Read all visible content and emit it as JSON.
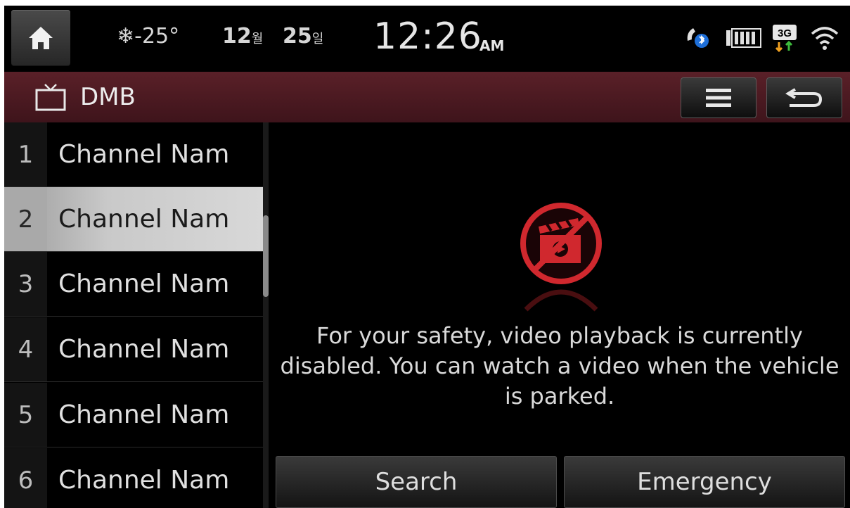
{
  "status_bar": {
    "weather_icon": "snowflake-icon",
    "temperature": "-25°",
    "date_month_num": "12",
    "date_month_unit": "월",
    "date_day_num": "25",
    "date_day_unit": "일",
    "time": "12:26",
    "ampm": "AM",
    "icons": [
      "bluetooth-phone-icon",
      "battery-icon",
      "3g-data-icon",
      "wifi-icon"
    ]
  },
  "header": {
    "icon": "tv-icon",
    "title": "DMB",
    "menu_icon": "menu-icon",
    "back_icon": "back-icon"
  },
  "channels": [
    {
      "number": "1",
      "name": "Channel Nam",
      "selected": false
    },
    {
      "number": "2",
      "name": "Channel Nam",
      "selected": true
    },
    {
      "number": "3",
      "name": "Channel Nam",
      "selected": false
    },
    {
      "number": "4",
      "name": "Channel Nam",
      "selected": false
    },
    {
      "number": "5",
      "name": "Channel Nam",
      "selected": false
    },
    {
      "number": "6",
      "name": "Channel Nam",
      "selected": false
    }
  ],
  "main": {
    "warning_icon": "video-disabled-icon",
    "message": "For your safety, video playback is currently disabled. You can watch a video when the vehicle is parked.",
    "search_label": "Search",
    "emergency_label": "Emergency"
  },
  "colors": {
    "header_bg": "#4a1820",
    "warning_red": "#d0282e",
    "selected_row": "#c9c9c9"
  }
}
